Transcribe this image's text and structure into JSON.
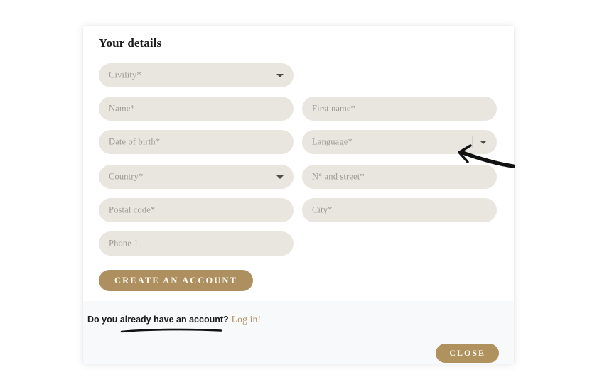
{
  "modal": {
    "title": "Your details",
    "fields": [
      {
        "name": "civility",
        "placeholder": "Civility*",
        "column": "left",
        "row": 1,
        "dropdown": true
      },
      {
        "name": "name",
        "placeholder": "Name*",
        "column": "left",
        "row": 2,
        "dropdown": false
      },
      {
        "name": "first-name",
        "placeholder": "First name*",
        "column": "right",
        "row": 2,
        "dropdown": false
      },
      {
        "name": "date-of-birth",
        "placeholder": "Date of birth*",
        "column": "left",
        "row": 3,
        "dropdown": false
      },
      {
        "name": "language",
        "placeholder": "Language*",
        "column": "right",
        "row": 3,
        "dropdown": true
      },
      {
        "name": "country",
        "placeholder": "Country*",
        "column": "left",
        "row": 4,
        "dropdown": true
      },
      {
        "name": "street",
        "placeholder": "N° and street*",
        "column": "right",
        "row": 4,
        "dropdown": false
      },
      {
        "name": "postal-code",
        "placeholder": "Postal code*",
        "column": "left",
        "row": 5,
        "dropdown": false
      },
      {
        "name": "city",
        "placeholder": "City*",
        "column": "right",
        "row": 5,
        "dropdown": false
      },
      {
        "name": "phone",
        "placeholder": "Phone 1",
        "column": "left",
        "row": 6,
        "dropdown": false
      }
    ],
    "create_account_label": "CREATE AN ACCOUNT",
    "footer": {
      "account_prompt": "Do you already have an account?",
      "login_link": "Log in!",
      "close_label": "CLOSE"
    }
  },
  "colors": {
    "accent_gold": "#ad8f60",
    "field_background": "#e8e6df",
    "placeholder_text": "#a09a90",
    "footer_background": "#f8f9fb",
    "annotation": "#111111"
  },
  "annotations": [
    {
      "name": "arrow-to-language-field",
      "shape": "arrow",
      "points_to": "language"
    },
    {
      "name": "underline-account-prompt",
      "shape": "underline",
      "points_to": "account_prompt"
    }
  ]
}
